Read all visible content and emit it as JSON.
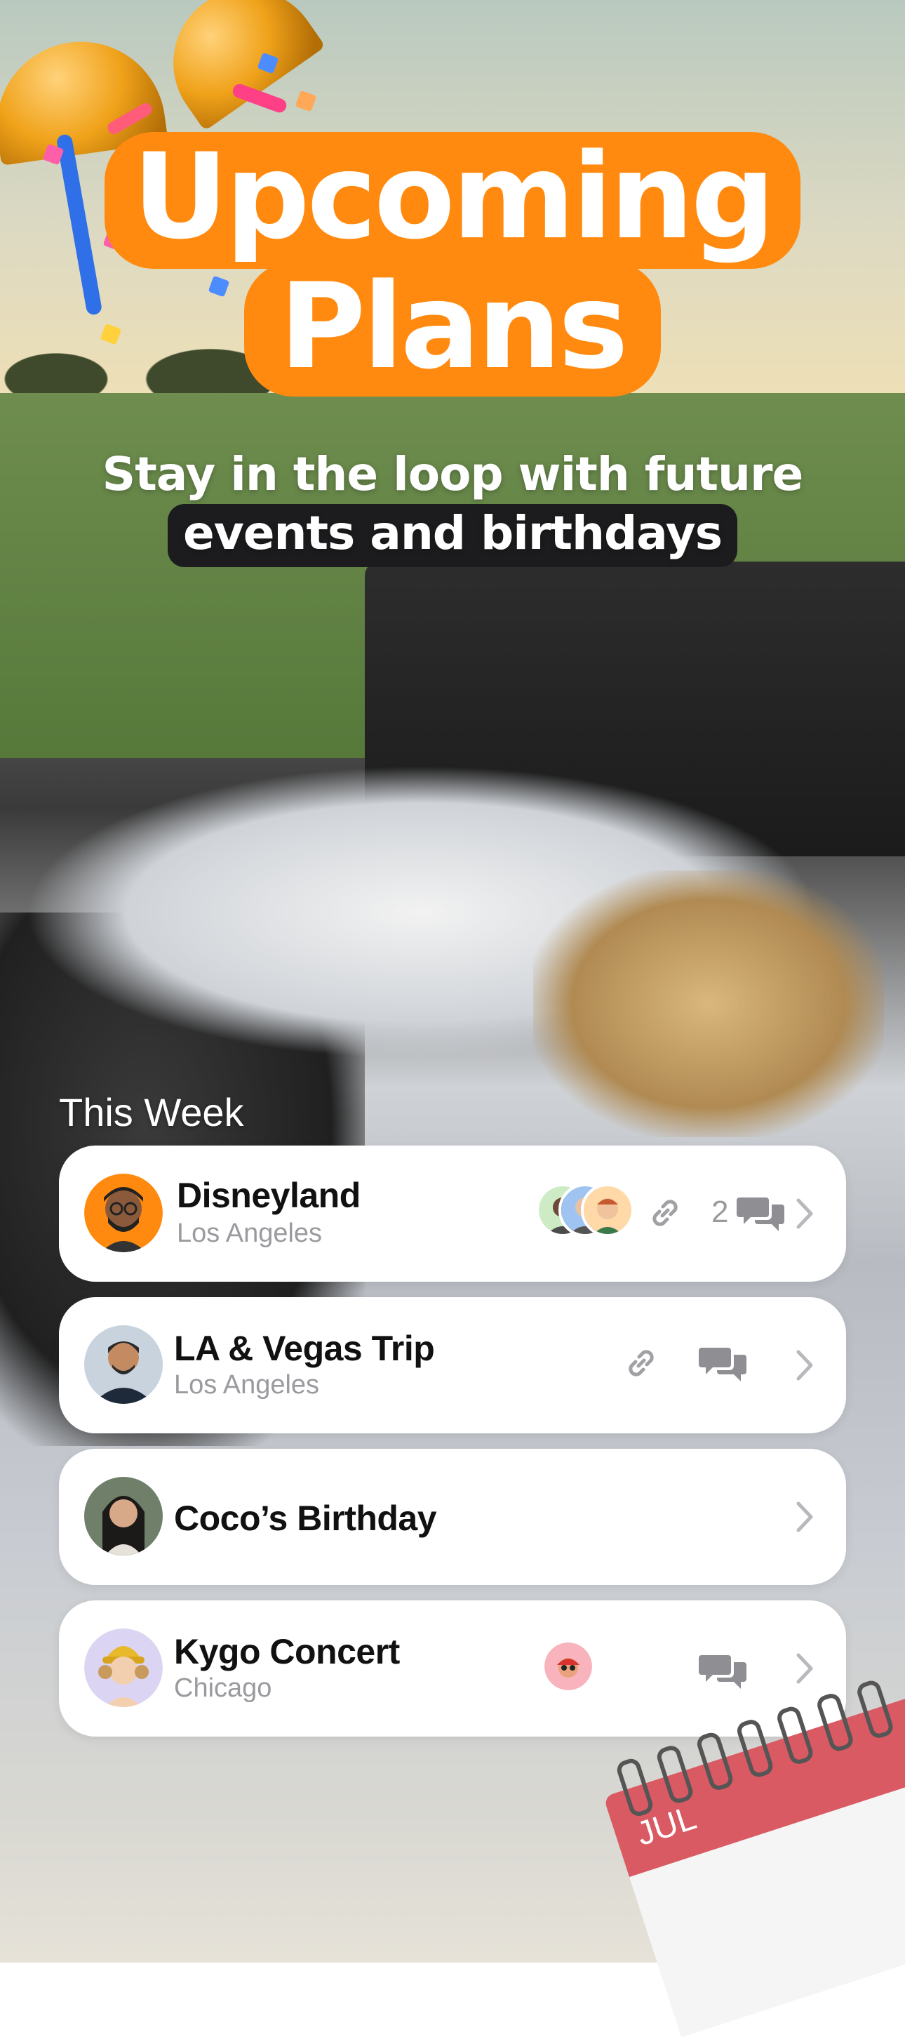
{
  "headline": {
    "line1": "Upcoming",
    "line2": "Plans"
  },
  "subheadline": {
    "line1": "Stay in the loop with future",
    "line2": "events and birthdays"
  },
  "section": {
    "label": "This Week"
  },
  "events": [
    {
      "name": "Disneyland",
      "location": "Los Angeles",
      "avatar_icon": "memoji-glasses-beard-icon",
      "avatar_bg": "#ff8a0f",
      "attendees_icon": "attendee-avatars-stack-icon",
      "has_link": true,
      "comment_count": "2",
      "has_chat": true
    },
    {
      "name": "LA & Vegas Trip",
      "location": "Los Angeles",
      "avatar_icon": "profile-photo-man-icon",
      "has_link": true,
      "has_chat": true
    },
    {
      "name": "Coco’s Birthday",
      "location": "",
      "avatar_icon": "profile-photo-woman-icon"
    },
    {
      "name": "Kygo Concert",
      "location": "Chicago",
      "avatar_icon": "memoji-yellow-hat-icon",
      "attendees_icon": "attendee-avatar-red-cap-icon",
      "has_chat": true
    }
  ],
  "calendar_decoration": {
    "month": "JUL"
  },
  "colors": {
    "accent_orange": "#ff8a0f",
    "card_bg": "#ffffff",
    "text_primary": "#111111",
    "text_secondary": "#9a9a9f",
    "highlight_dark": "#1c1c1e",
    "calendar_red": "#d95a63"
  }
}
